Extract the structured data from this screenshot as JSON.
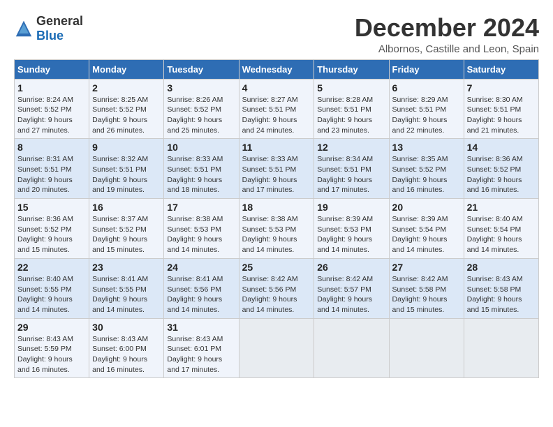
{
  "header": {
    "logo_general": "General",
    "logo_blue": "Blue",
    "month_title": "December 2024",
    "location": "Albornos, Castille and Leon, Spain"
  },
  "weekdays": [
    "Sunday",
    "Monday",
    "Tuesday",
    "Wednesday",
    "Thursday",
    "Friday",
    "Saturday"
  ],
  "weeks": [
    [
      {
        "day": "1",
        "sunrise": "8:24 AM",
        "sunset": "5:52 PM",
        "daylight": "9 hours and 27 minutes."
      },
      {
        "day": "2",
        "sunrise": "8:25 AM",
        "sunset": "5:52 PM",
        "daylight": "9 hours and 26 minutes."
      },
      {
        "day": "3",
        "sunrise": "8:26 AM",
        "sunset": "5:52 PM",
        "daylight": "9 hours and 25 minutes."
      },
      {
        "day": "4",
        "sunrise": "8:27 AM",
        "sunset": "5:51 PM",
        "daylight": "9 hours and 24 minutes."
      },
      {
        "day": "5",
        "sunrise": "8:28 AM",
        "sunset": "5:51 PM",
        "daylight": "9 hours and 23 minutes."
      },
      {
        "day": "6",
        "sunrise": "8:29 AM",
        "sunset": "5:51 PM",
        "daylight": "9 hours and 22 minutes."
      },
      {
        "day": "7",
        "sunrise": "8:30 AM",
        "sunset": "5:51 PM",
        "daylight": "9 hours and 21 minutes."
      }
    ],
    [
      {
        "day": "8",
        "sunrise": "8:31 AM",
        "sunset": "5:51 PM",
        "daylight": "9 hours and 20 minutes."
      },
      {
        "day": "9",
        "sunrise": "8:32 AM",
        "sunset": "5:51 PM",
        "daylight": "9 hours and 19 minutes."
      },
      {
        "day": "10",
        "sunrise": "8:33 AM",
        "sunset": "5:51 PM",
        "daylight": "9 hours and 18 minutes."
      },
      {
        "day": "11",
        "sunrise": "8:33 AM",
        "sunset": "5:51 PM",
        "daylight": "9 hours and 17 minutes."
      },
      {
        "day": "12",
        "sunrise": "8:34 AM",
        "sunset": "5:51 PM",
        "daylight": "9 hours and 17 minutes."
      },
      {
        "day": "13",
        "sunrise": "8:35 AM",
        "sunset": "5:52 PM",
        "daylight": "9 hours and 16 minutes."
      },
      {
        "day": "14",
        "sunrise": "8:36 AM",
        "sunset": "5:52 PM",
        "daylight": "9 hours and 16 minutes."
      }
    ],
    [
      {
        "day": "15",
        "sunrise": "8:36 AM",
        "sunset": "5:52 PM",
        "daylight": "9 hours and 15 minutes."
      },
      {
        "day": "16",
        "sunrise": "8:37 AM",
        "sunset": "5:52 PM",
        "daylight": "9 hours and 15 minutes."
      },
      {
        "day": "17",
        "sunrise": "8:38 AM",
        "sunset": "5:53 PM",
        "daylight": "9 hours and 14 minutes."
      },
      {
        "day": "18",
        "sunrise": "8:38 AM",
        "sunset": "5:53 PM",
        "daylight": "9 hours and 14 minutes."
      },
      {
        "day": "19",
        "sunrise": "8:39 AM",
        "sunset": "5:53 PM",
        "daylight": "9 hours and 14 minutes."
      },
      {
        "day": "20",
        "sunrise": "8:39 AM",
        "sunset": "5:54 PM",
        "daylight": "9 hours and 14 minutes."
      },
      {
        "day": "21",
        "sunrise": "8:40 AM",
        "sunset": "5:54 PM",
        "daylight": "9 hours and 14 minutes."
      }
    ],
    [
      {
        "day": "22",
        "sunrise": "8:40 AM",
        "sunset": "5:55 PM",
        "daylight": "9 hours and 14 minutes."
      },
      {
        "day": "23",
        "sunrise": "8:41 AM",
        "sunset": "5:55 PM",
        "daylight": "9 hours and 14 minutes."
      },
      {
        "day": "24",
        "sunrise": "8:41 AM",
        "sunset": "5:56 PM",
        "daylight": "9 hours and 14 minutes."
      },
      {
        "day": "25",
        "sunrise": "8:42 AM",
        "sunset": "5:56 PM",
        "daylight": "9 hours and 14 minutes."
      },
      {
        "day": "26",
        "sunrise": "8:42 AM",
        "sunset": "5:57 PM",
        "daylight": "9 hours and 14 minutes."
      },
      {
        "day": "27",
        "sunrise": "8:42 AM",
        "sunset": "5:58 PM",
        "daylight": "9 hours and 15 minutes."
      },
      {
        "day": "28",
        "sunrise": "8:43 AM",
        "sunset": "5:58 PM",
        "daylight": "9 hours and 15 minutes."
      }
    ],
    [
      {
        "day": "29",
        "sunrise": "8:43 AM",
        "sunset": "5:59 PM",
        "daylight": "9 hours and 16 minutes."
      },
      {
        "day": "30",
        "sunrise": "8:43 AM",
        "sunset": "6:00 PM",
        "daylight": "9 hours and 16 minutes."
      },
      {
        "day": "31",
        "sunrise": "8:43 AM",
        "sunset": "6:01 PM",
        "daylight": "9 hours and 17 minutes."
      },
      null,
      null,
      null,
      null
    ]
  ],
  "labels": {
    "sunrise": "Sunrise:",
    "sunset": "Sunset:",
    "daylight": "Daylight:"
  }
}
